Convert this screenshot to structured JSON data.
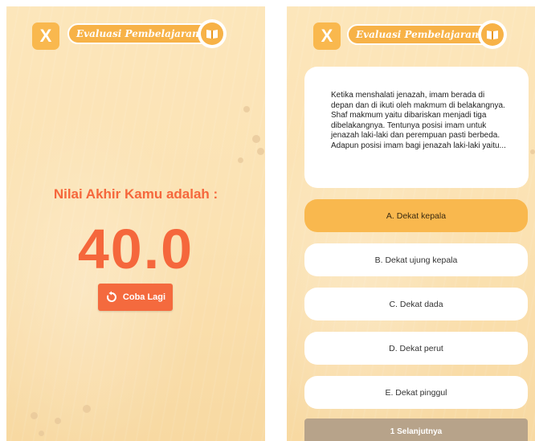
{
  "header": {
    "close_label": "X",
    "title": "Evaluasi Pembelajaran"
  },
  "result_screen": {
    "score_label": "Nilai Akhir Kamu adalah :",
    "score_value": "40.0",
    "retry_label": "Coba Lagi"
  },
  "quiz_screen": {
    "question": "Ketika menshalati jenazah, imam berada di depan dan di ikuti oleh makmum di belakangnya. Shaf makmum yaitu dibariskan menjadi tiga dibelakangnya. Tentunya posisi imam untuk jenazah laki-laki dan perempuan pasti berbeda. Adapun posisi imam bagi jenazah laki-laki yaitu...",
    "options": [
      {
        "label": "A. Dekat kepala",
        "selected": true
      },
      {
        "label": "B. Dekat ujung kepala",
        "selected": false
      },
      {
        "label": "C. Dekat dada",
        "selected": false
      },
      {
        "label": "D. Dekat perut",
        "selected": false
      },
      {
        "label": "E. Dekat pinggul",
        "selected": false
      }
    ],
    "next_label": "1 Selanjutnya"
  },
  "colors": {
    "accent": "#f9b84e",
    "score": "#f5673c",
    "retry_button": "#f46a3e",
    "next_button": "#b7a38a",
    "background": "#fbe2b3"
  },
  "icons": {
    "close": "close-icon",
    "book": "book-icon",
    "retry": "retry-icon"
  }
}
